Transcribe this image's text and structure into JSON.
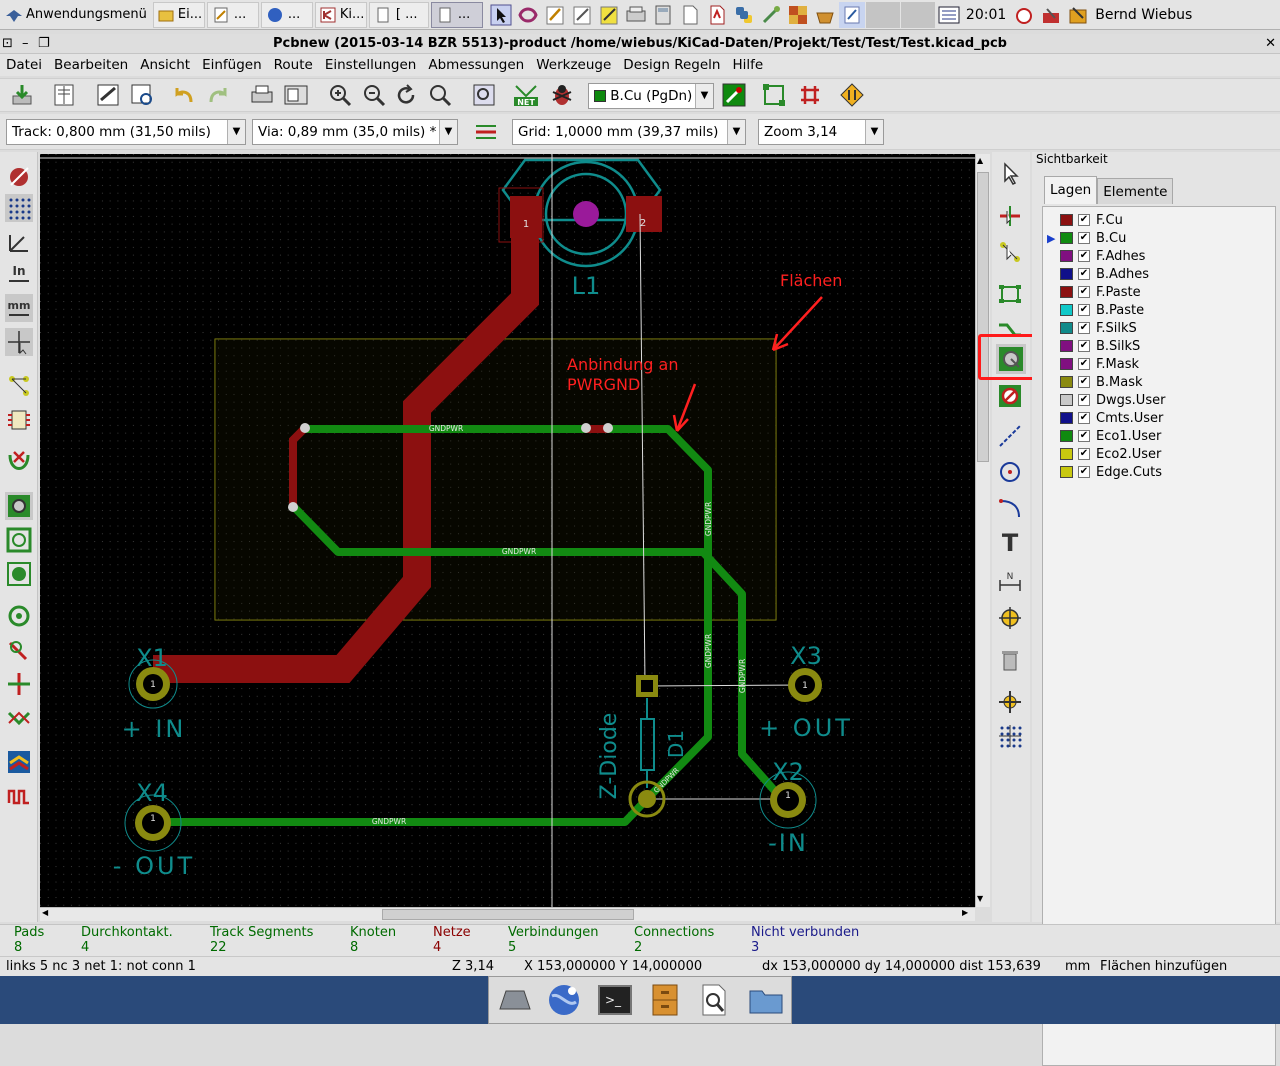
{
  "taskbar": {
    "start_label": "Anwendungsmenü",
    "tasks": [
      "Ei...",
      "...",
      "...",
      "Ki...",
      "[ ...",
      "..."
    ],
    "clock": "20:01",
    "user": "Bernd Wiebus"
  },
  "window": {
    "title": "Pcbnew (2015-03-14 BZR 5513)-product /home/wiebus/KiCad-Daten/Projekt/Test/Test/Test.kicad_pcb"
  },
  "menu": [
    "Datei",
    "Bearbeiten",
    "Ansicht",
    "Einfügen",
    "Route",
    "Einstellungen",
    "Abmessungen",
    "Werkzeuge",
    "Design Regeln",
    "Hilfe"
  ],
  "toolbar": {
    "layer_select": "B.Cu (PgDn)",
    "track": "Track: 0,800 mm (31,50 mils)",
    "via": "Via: 0,89 mm (35,0 mils) *",
    "grid": "Grid: 1,0000 mm (39,37 mils)",
    "zoom": "Zoom 3,14"
  },
  "canvas": {
    "ref_l1": "L1",
    "pad1": "1",
    "pad2": "2",
    "net_label": "GNDPWR",
    "annotation_flaechen": "Flächen",
    "annotation_anbindung_1": "Anbindung an",
    "annotation_anbindung_2": "PWRGND",
    "x1": "X1",
    "x1_label": "+ IN",
    "x2": "X2",
    "x2_label": "-IN",
    "x3": "X3",
    "x3_label": "+ OUT",
    "x4": "X4",
    "x4_label": "- OUT",
    "d1": "D1",
    "zdiode": "Z-Diode",
    "colors": {
      "background": "#000000",
      "fcu_track": "#8c1010",
      "bcu_track": "#128a12",
      "silk": "#0f8c8c",
      "annotation": "#ff2020"
    }
  },
  "visibility": {
    "title": "Sichtbarkeit",
    "tabs": [
      "Lagen",
      "Elemente"
    ],
    "layers": [
      {
        "name": "F.Cu",
        "color": "#8b1010"
      },
      {
        "name": "B.Cu",
        "color": "#0f8a0f"
      },
      {
        "name": "F.Adhes",
        "color": "#801080"
      },
      {
        "name": "B.Adhes",
        "color": "#10108a"
      },
      {
        "name": "F.Paste",
        "color": "#8b1010"
      },
      {
        "name": "B.Paste",
        "color": "#10c8c8"
      },
      {
        "name": "F.SilkS",
        "color": "#108a8a"
      },
      {
        "name": "B.SilkS",
        "color": "#801080"
      },
      {
        "name": "F.Mask",
        "color": "#801080"
      },
      {
        "name": "B.Mask",
        "color": "#8a8a10"
      },
      {
        "name": "Dwgs.User",
        "color": "#c8c8c8"
      },
      {
        "name": "Cmts.User",
        "color": "#10108a"
      },
      {
        "name": "Eco1.User",
        "color": "#108a10"
      },
      {
        "name": "Eco2.User",
        "color": "#c8c810"
      },
      {
        "name": "Edge.Cuts",
        "color": "#c8c810"
      }
    ]
  },
  "status": {
    "items": [
      {
        "label": "Pads",
        "value": "8",
        "color": "#006a00"
      },
      {
        "label": "Durchkontakt.",
        "value": "4",
        "color": "#006a00"
      },
      {
        "label": "Track Segments",
        "value": "22",
        "color": "#006a00"
      },
      {
        "label": "Knoten",
        "value": "8",
        "color": "#006a00"
      },
      {
        "label": "Netze",
        "value": "4",
        "color": "#8a0000"
      },
      {
        "label": "Verbindungen",
        "value": "5",
        "color": "#006a00"
      },
      {
        "label": "Connections",
        "value": "2",
        "color": "#006a00"
      },
      {
        "label": "Nicht verbunden",
        "value": "3",
        "color": "#1a1a8a"
      }
    ],
    "bar": {
      "links": "links 5 nc 3  net 1: not conn 1",
      "zoom": "Z 3,14",
      "coords": "X 153,000000  Y 14,000000",
      "delta": "dx 153,000000 dy 14,000000 dist 153,639",
      "unit": "mm",
      "mode": "Flächen hinzufügen"
    }
  }
}
